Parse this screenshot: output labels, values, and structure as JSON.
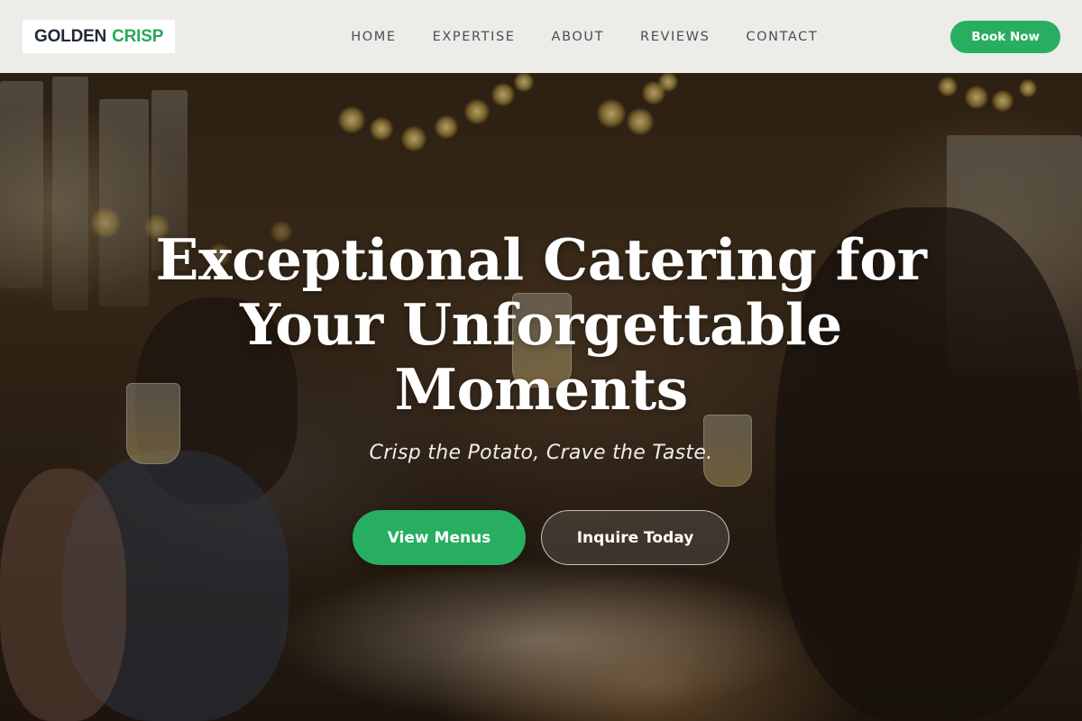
{
  "brand": {
    "name_part1": "GOLDEN",
    "name_part2": "CRISP",
    "accent_color": "#27ae60"
  },
  "nav": {
    "links": [
      "HOME",
      "EXPERTISE",
      "ABOUT",
      "REVIEWS",
      "CONTACT"
    ],
    "cta_label": "Book Now"
  },
  "hero": {
    "title": "Exceptional Catering for Your Unforgettable Moments",
    "tagline": "Crisp the Potato, Crave the Taste.",
    "primary_button": "View Menus",
    "secondary_button": "Inquire Today",
    "background_image": "celebration-dinner-toast-photo"
  }
}
